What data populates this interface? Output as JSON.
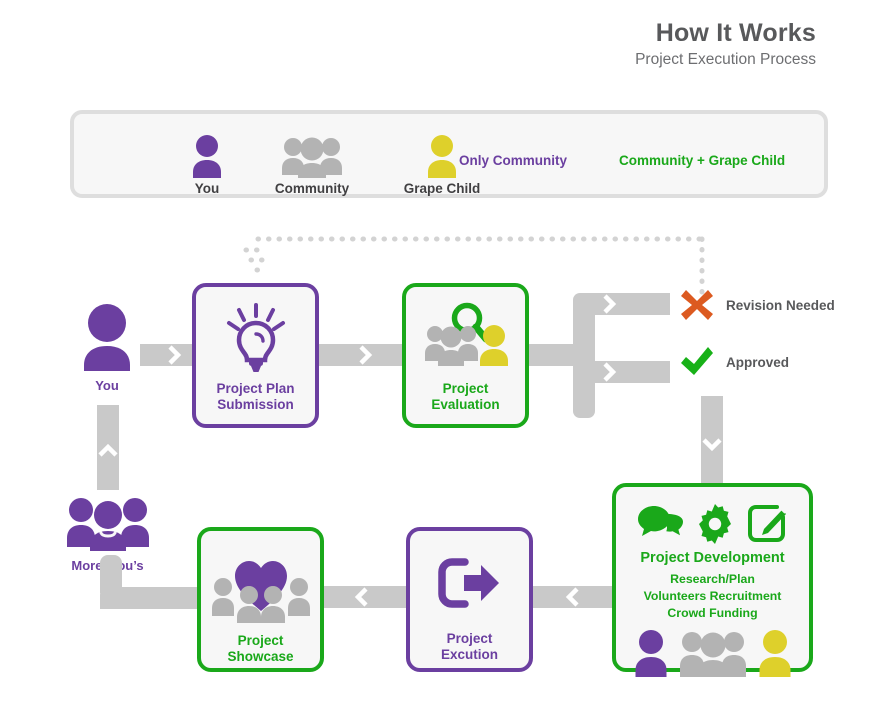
{
  "header": {
    "title": "How It Works",
    "subtitle": "Project Execution Process"
  },
  "colors": {
    "purple": "#6B3FA0",
    "green": "#1AA81A",
    "yellow": "#DED02B",
    "gray": "#C9C9C9",
    "gray_dark": "#B3B3B3",
    "orange": "#DC5A20",
    "panel_bg": "#F7F7F7",
    "panel_border": "#DEDEDE",
    "text_dark": "#58595B"
  },
  "legend": {
    "items": [
      {
        "label": "You",
        "icon": "single-person-icon",
        "color": "#6B3FA0"
      },
      {
        "label": "Community",
        "icon": "people-group-icon",
        "color": "#B3B3B3"
      },
      {
        "label": "Grape Child",
        "icon": "single-person-icon",
        "color": "#DED02B"
      }
    ],
    "notes": [
      {
        "label": "Only Community",
        "color": "#6B3FA0"
      },
      {
        "label": "Community + Grape Child",
        "color": "#1AA81A"
      }
    ]
  },
  "actors": [
    {
      "name": "you",
      "label": "You",
      "icon": "single-person-icon",
      "color": "#6B3FA0"
    },
    {
      "name": "more-yous",
      "label": "More ‘You’s",
      "icon": "people-group-icon",
      "color": "#6B3FA0"
    }
  ],
  "steps": [
    {
      "id": "project-plan-submission",
      "label": "Project Plan\nSubmission",
      "label_lines": [
        "Project Plan",
        "Submission"
      ],
      "accent": "#6B3FA0",
      "accent_name": "purple",
      "icons": [
        "lightbulb-icon"
      ]
    },
    {
      "id": "project-evaluation",
      "label": "Project\nEvaluation",
      "label_lines": [
        "Project",
        "Evaluation"
      ],
      "accent": "#1AA81A",
      "accent_name": "green",
      "icons": [
        "magnifier-icon",
        "people-group-icon",
        "single-person-icon"
      ]
    },
    {
      "id": "project-development",
      "label": "Project Development",
      "label_lines": [
        "Project Development"
      ],
      "accent": "#1AA81A",
      "accent_name": "green",
      "icons": [
        "speech-bubbles-icon",
        "gear-icon",
        "edit-square-icon"
      ],
      "sub_items": [
        "Research/Plan",
        "Volunteers Recruitment",
        "Crowd Funding"
      ],
      "participant_icons": [
        "single-person-icon",
        "people-group-icon",
        "single-person-icon"
      ]
    },
    {
      "id": "project-excution",
      "label": "Project\nExcution",
      "label_lines": [
        "Project",
        "Excution"
      ],
      "accent": "#6B3FA0",
      "accent_name": "purple",
      "icons": [
        "exit-arrow-icon"
      ]
    },
    {
      "id": "project-showcase",
      "label": "Project\nShowcase",
      "label_lines": [
        "Project",
        "Showcase"
      ],
      "accent": "#1AA81A",
      "accent_name": "green",
      "icons": [
        "heart-over-crowd-icon"
      ]
    }
  ],
  "outcomes": [
    {
      "id": "revision-needed",
      "label": "Revision Needed",
      "icon": "cross-x-icon",
      "color": "#DC5A20"
    },
    {
      "id": "approved",
      "label": "Approved",
      "icon": "check-mark-icon",
      "color": "#1AA81A"
    }
  ]
}
